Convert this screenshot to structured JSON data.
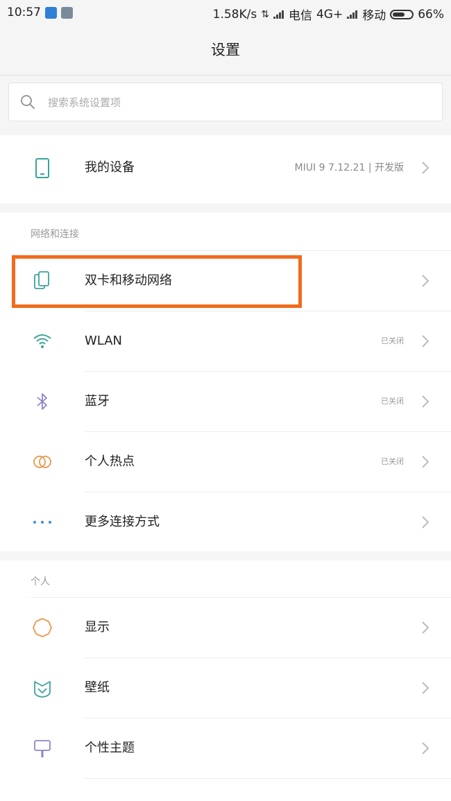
{
  "status_bar": {
    "time": "10:57",
    "speed": "1.58K/s",
    "data_arrows": "⇅",
    "carrier1": "电信",
    "network1": "4G+",
    "carrier2": "移动",
    "battery_percent": "66%",
    "battery_level": 0.66
  },
  "page": {
    "title": "设置"
  },
  "search": {
    "placeholder": "搜索系统设置项"
  },
  "device": {
    "label": "我的设备",
    "value": "MIUI 9 7.12.21 | 开发版"
  },
  "network_section": {
    "header": "网络和连接",
    "items": [
      {
        "label": "双卡和移动网络",
        "value": "",
        "icon": "dual-sim-icon"
      },
      {
        "label": "WLAN",
        "value": "已关闭",
        "icon": "wifi-icon"
      },
      {
        "label": "蓝牙",
        "value": "已关闭",
        "icon": "bluetooth-icon"
      },
      {
        "label": "个人热点",
        "value": "已关闭",
        "icon": "hotspot-icon"
      },
      {
        "label": "更多连接方式",
        "value": "",
        "icon": "more-dots-icon"
      }
    ]
  },
  "personal_section": {
    "header": "个人",
    "items": [
      {
        "label": "显示",
        "icon": "display-icon"
      },
      {
        "label": "壁纸",
        "icon": "wallpaper-icon"
      },
      {
        "label": "个性主题",
        "icon": "theme-icon"
      }
    ]
  },
  "colors": {
    "highlight": "#f26b1d",
    "icon_teal": "#3aa39a",
    "icon_orange": "#e8974a",
    "icon_purple": "#8a86c8",
    "icon_blue": "#3a8fd8"
  }
}
